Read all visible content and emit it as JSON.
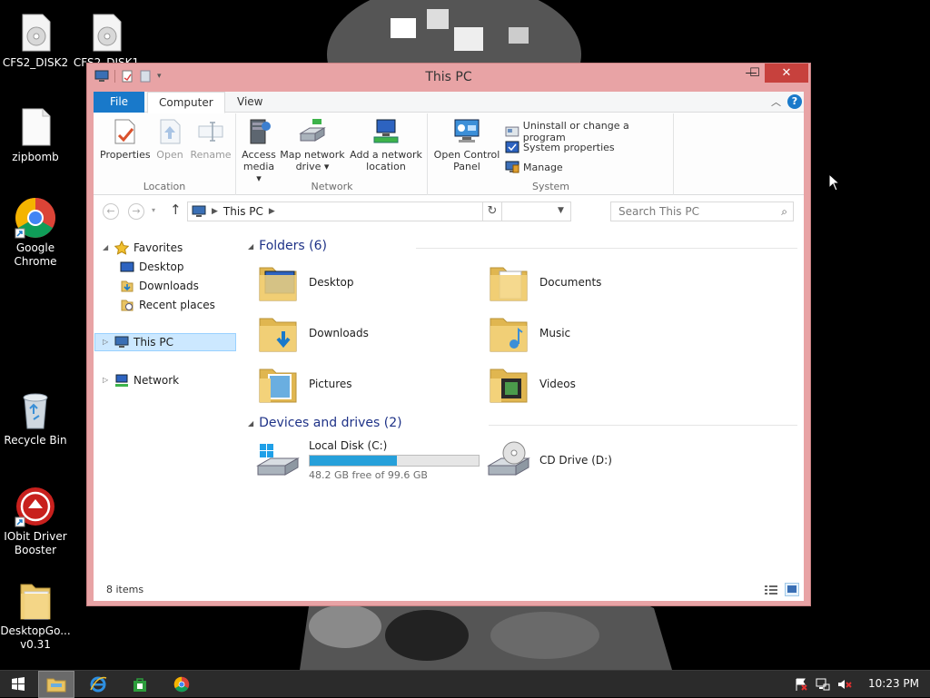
{
  "desktop": {
    "icons": [
      {
        "label": "CFS2_DISK2"
      },
      {
        "label": "CFS2_DISK1"
      },
      {
        "label": "zipbomb"
      },
      {
        "label": "Google Chrome"
      },
      {
        "label": "Recycle Bin"
      },
      {
        "label": "IObit Driver Booster"
      },
      {
        "label": "DesktopGo... v0.31"
      }
    ]
  },
  "window": {
    "title": "This PC",
    "caption_buttons": {
      "minimize": "—",
      "maximize": "☐",
      "close": "✕"
    }
  },
  "ribbon": {
    "tabs": {
      "file": "File",
      "computer": "Computer",
      "view": "View"
    },
    "groups": {
      "location": {
        "label": "Location",
        "properties": "Properties",
        "open": "Open",
        "rename": "Rename"
      },
      "network": {
        "label": "Network",
        "access_media_line1": "Access",
        "access_media_line2": "media",
        "map_drive_line1": "Map network",
        "map_drive_line2": "drive",
        "add_location_line1": "Add a network",
        "add_location_line2": "location"
      },
      "system": {
        "label": "System",
        "open_cp_line1": "Open Control",
        "open_cp_line2": "Panel",
        "uninstall": "Uninstall or change a program",
        "system_properties": "System properties",
        "manage": "Manage"
      }
    }
  },
  "address": {
    "breadcrumb": "This PC",
    "search_placeholder": "Search This PC"
  },
  "nav_pane": {
    "favorites": "Favorites",
    "desktop": "Desktop",
    "downloads": "Downloads",
    "recent": "Recent places",
    "this_pc": "This PC",
    "network": "Network"
  },
  "content": {
    "folders_header": "Folders (6)",
    "folders": [
      {
        "name": "Desktop"
      },
      {
        "name": "Documents"
      },
      {
        "name": "Downloads"
      },
      {
        "name": "Music"
      },
      {
        "name": "Pictures"
      },
      {
        "name": "Videos"
      }
    ],
    "devices_header": "Devices and drives (2)",
    "drives": [
      {
        "name": "Local Disk (C:)",
        "free": "48.2 GB free of 99.6 GB",
        "used_fraction": 0.516
      },
      {
        "name": "CD Drive (D:)"
      }
    ]
  },
  "status": {
    "item_count": "8 items"
  },
  "taskbar": {
    "clock": "10:23 PM"
  },
  "colors": {
    "window_frame": "#e8a3a5",
    "close_button": "#c7413d",
    "file_tab": "#1979ca",
    "usage_bar": "#26a0da",
    "selection": "#cce8ff"
  }
}
